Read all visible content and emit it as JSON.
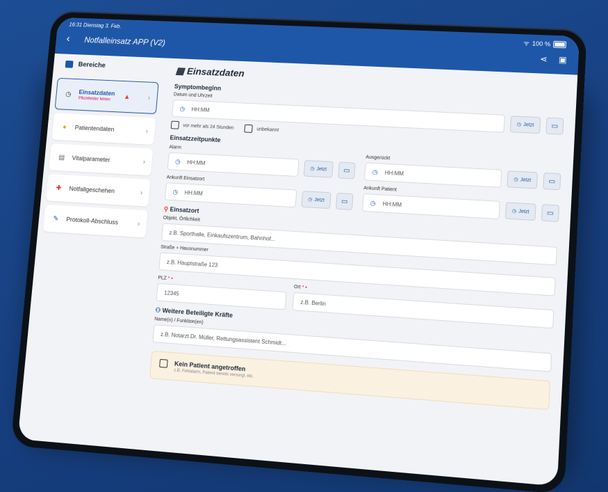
{
  "status": {
    "time": "16:31",
    "date": "Dienstag 3. Feb.",
    "battery": "100 %"
  },
  "app": {
    "title": "Notfalleinsatz APP (V2)"
  },
  "sidebar": {
    "heading": "Bereiche",
    "items": [
      {
        "label": "Einsatzdaten",
        "sub": "Pflichtfelder fehlen",
        "icon": "clock-icon",
        "active": true
      },
      {
        "label": "Patientendaten",
        "icon": "person-icon"
      },
      {
        "label": "Vitalparameter",
        "icon": "document-icon"
      },
      {
        "label": "Notfallgeschehen",
        "icon": "medkit-icon"
      },
      {
        "label": "Protokoll-Abschluss",
        "icon": "pen-icon"
      }
    ]
  },
  "main": {
    "title": "Einsatzdaten",
    "symptom": {
      "section": "Symptombeginn",
      "label": "Datum und Uhrzeit",
      "placeholder": "HH:MM",
      "over24": "vor mehr als 24 Stunden",
      "unknown": "unbekannt"
    },
    "times": {
      "section": "Einsatzzeitpunkte",
      "alarm": "Alarm",
      "ausgerueckt": "Ausgerückt",
      "ankunft_einsatzort": "Ankunft Einsatzort",
      "ankunft_patient": "Ankunft Patient",
      "placeholder": "HH:MM"
    },
    "buttons": {
      "now": "Jetzt"
    },
    "place": {
      "section": "Einsatzort",
      "object_label": "Objekt, Örtlichkeit",
      "object_ph": "z.B. Sporthalle, Einkaufszentrum, Bahnhof...",
      "street_label": "Straße + Hausnummer",
      "street_ph": "z.B. Hauptstraße 123",
      "plz_label": "PLZ",
      "plz_ph": "12345",
      "ort_label": "Ort",
      "ort_ph": "z.B. Berlin",
      "req_mark": "* •"
    },
    "forces": {
      "section": "Weitere Beteiligte Kräfte",
      "label": "Name(n) / Funktion(en)",
      "placeholder": "z.B. Notarzt Dr. Müller, Rettungsassistent Schmidt..."
    },
    "nopatient": {
      "title": "Kein Patient angetroffen",
      "sub": "z.B. Fehlalarm, Patient bereits versorgt, etc."
    }
  },
  "colors": {
    "accent": "#1f57a8",
    "background": "#1d4d94",
    "warning": "#e5432b"
  }
}
